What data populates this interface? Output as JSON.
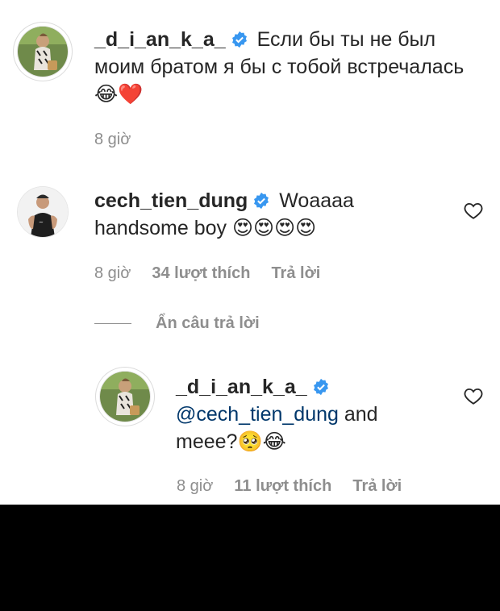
{
  "comments": [
    {
      "username": "_d_i_an_k_a_",
      "text": "Если бы ты не был моим братом я бы с тобой встречалась",
      "emoji": "😂❤️",
      "time": "8 giờ"
    },
    {
      "username": "cech_tien_dung",
      "text": "Woaaaa handsome boy",
      "emoji": "😍😍😍😍",
      "time": "8 giờ",
      "likes": "34 lượt thích",
      "reply_label": "Trả lời"
    }
  ],
  "hide_replies_label": "Ẩn câu trả lời",
  "reply": {
    "username": "_d_i_an_k_a_",
    "mention": "@cech_tien_dung",
    "text": "and meee?",
    "emoji": "🥺😂",
    "time": "8 giờ",
    "likes": "11 lượt thích",
    "reply_label": "Trả lời"
  },
  "colors": {
    "verified": "#3897f0",
    "mention": "#00376b",
    "meta": "#8e8e8e"
  },
  "icons": [
    "verified-badge-icon",
    "heart-outline-icon"
  ]
}
